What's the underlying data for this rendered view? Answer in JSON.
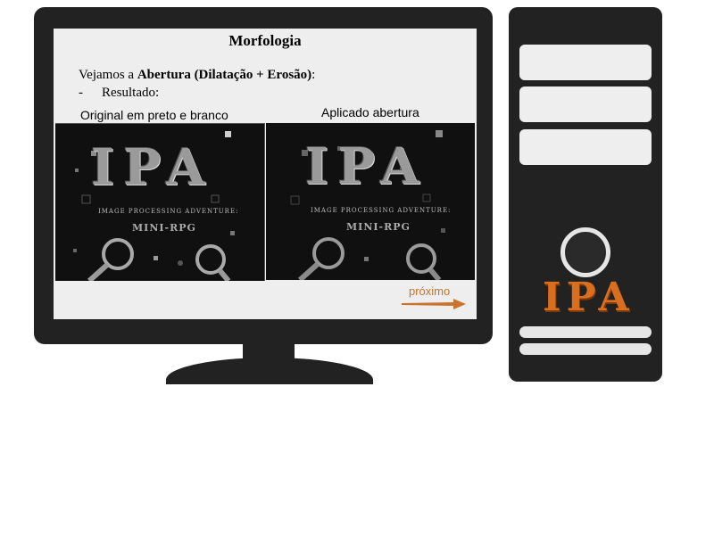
{
  "slide": {
    "title": "Morfologia",
    "intro_prefix": "Vejamos a ",
    "intro_bold": "Abertura (Dilatação + Erosão)",
    "intro_suffix": ":",
    "bullet_dash": "-",
    "bullet_text": "Resultado:",
    "caption_left": "Original em preto e branco",
    "caption_right": "Aplicado abertura",
    "next_label": "próximo"
  },
  "logo": {
    "main": "IPA",
    "subtitle": "IMAGE PROCESSING ADVENTURE:",
    "mini": "MINI-RPG"
  },
  "tower": {
    "logo": "IPA"
  },
  "colors": {
    "device": "#222222",
    "screen": "#eeeeee",
    "accent_orange": "#d96f1e",
    "next_text": "#c8742c"
  },
  "icons": {
    "magnifier": "magnifier-icon",
    "arrow": "arrow-right-icon",
    "power": "power-button-icon"
  }
}
